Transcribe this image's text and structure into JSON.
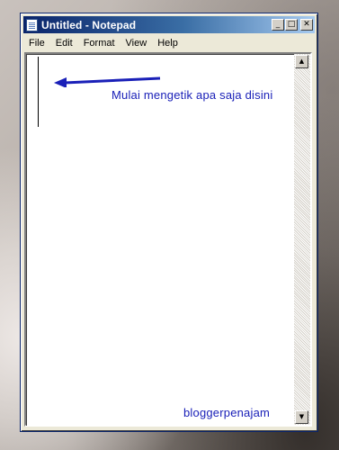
{
  "window": {
    "title": "Untitled - Notepad",
    "buttons": {
      "minimize": "_",
      "maximize": "□",
      "close": "✕"
    }
  },
  "menu": [
    "File",
    "Edit",
    "Format",
    "View",
    "Help"
  ],
  "editor": {
    "hint": "Mulai mengetik apa saja disini",
    "signature": "bloggerpenajam"
  },
  "scrollbar": {
    "up": "▲",
    "down": "▼"
  },
  "colors": {
    "annotation": "#1a20b8",
    "title_gradient_start": "#0a246a",
    "title_gradient_end": "#a6caf0"
  },
  "icons": [
    "notepad-icon",
    "arrow-left-icon"
  ]
}
